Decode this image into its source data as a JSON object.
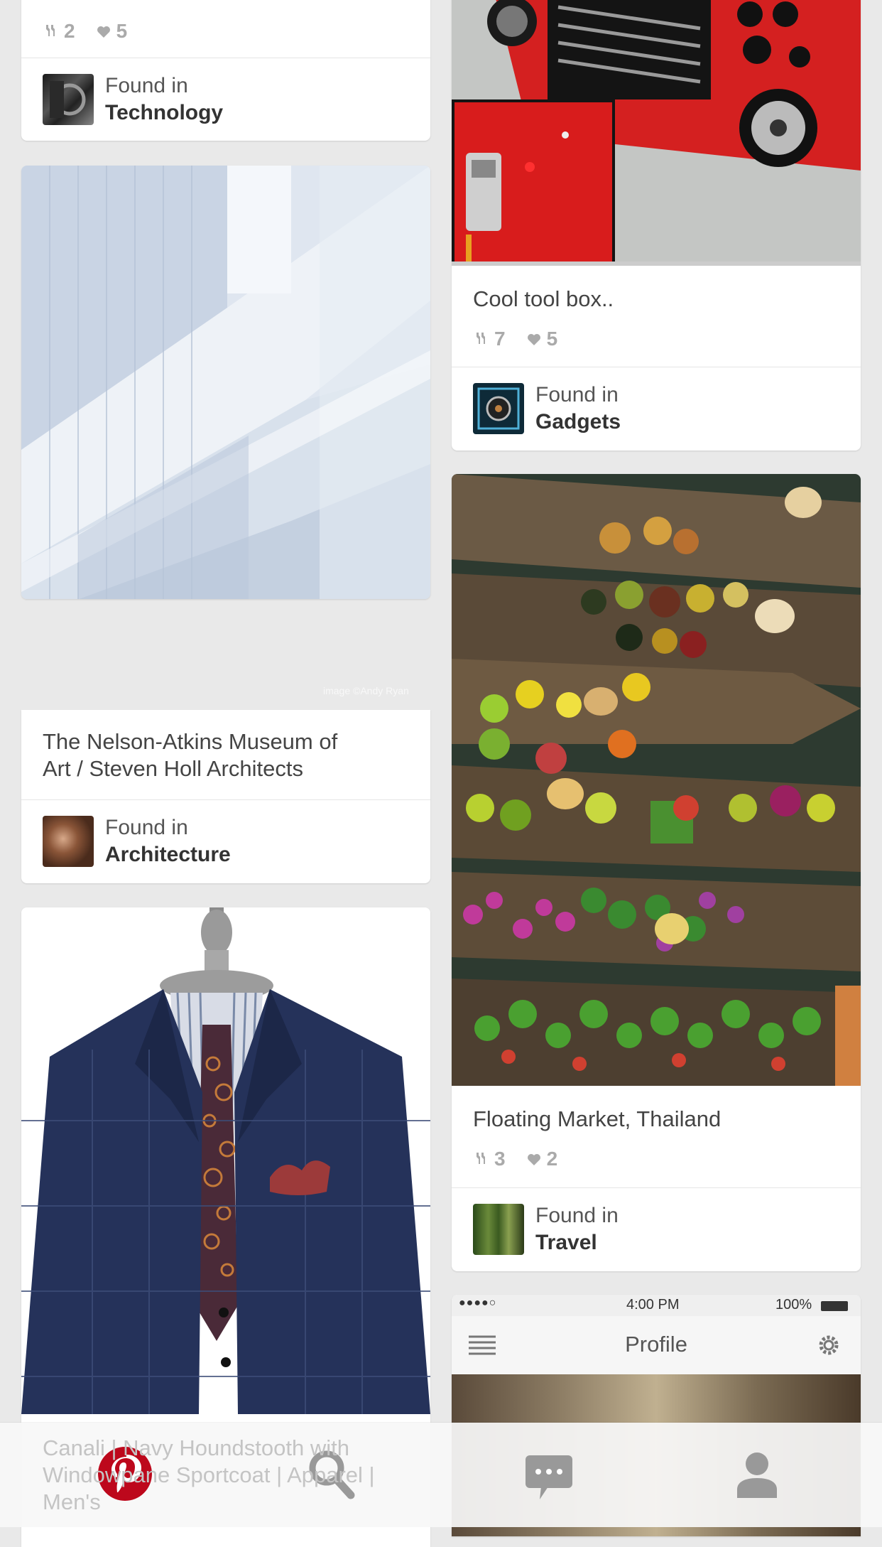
{
  "colors": {
    "pinterest_red": "#bd081c",
    "background": "#e9e9e9",
    "card": "#ffffff",
    "icon_gray": "#999999"
  },
  "cards": {
    "technology": {
      "repins": "2",
      "likes": "5",
      "found_label": "Found in",
      "board": "Technology"
    },
    "toolbox": {
      "title": "Cool tool box..",
      "repins": "7",
      "likes": "5",
      "found_label": "Found in",
      "board": "Gadgets"
    },
    "museum": {
      "title_line1": "The Nelson-Atkins Museum of",
      "title_line2": "Art / Steven Holl Architects",
      "image_credit": "image ©Andy Ryan",
      "found_label": "Found in",
      "board": "Architecture"
    },
    "market": {
      "title": "Floating Market, Thailand",
      "repins": "3",
      "likes": "2",
      "found_label": "Found in",
      "board": "Travel"
    },
    "suit": {
      "title_line1": "Canali | Navy Houndstooth with",
      "title_line2": "Windowpane Sportcoat | Apparel |",
      "title_line3": "Men's"
    },
    "profile_screenshot": {
      "signal": "●●●●○",
      "time": "4:00 PM",
      "battery": "100%",
      "header_title": "Profile"
    }
  },
  "bottom_nav": {
    "items": [
      {
        "icon": "pinterest-logo-icon",
        "label": "Home"
      },
      {
        "icon": "search-icon",
        "label": "Search"
      },
      {
        "icon": "chat-bubble-icon",
        "label": "Messages"
      },
      {
        "icon": "person-icon",
        "label": "Profile"
      }
    ]
  }
}
